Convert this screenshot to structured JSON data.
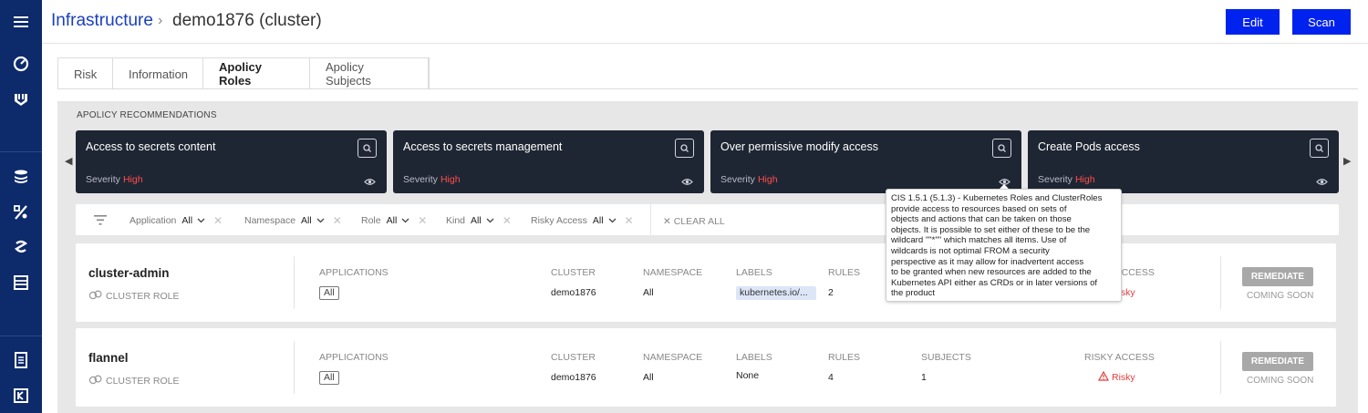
{
  "nav": {
    "icons": [
      "menu-icon",
      "gauge-icon",
      "shield-icon",
      "layers-icon",
      "percent-icon",
      "scan-icon",
      "server-icon",
      "document-icon",
      "compliance-icon"
    ]
  },
  "breadcrumb": {
    "root": "Infrastructure",
    "separator": "›",
    "current": "demo1876 (cluster)"
  },
  "header": {
    "edit_label": "Edit",
    "scan_label": "Scan",
    "accent": "#0022ee"
  },
  "tabs": [
    "Risk",
    "Information",
    "Apolicy Roles",
    "Apolicy Subjects"
  ],
  "active_tab": "Apolicy Roles",
  "recommendations": {
    "title": "APOLICY RECOMMENDATIONS",
    "severity_label": "Severity",
    "cards": [
      {
        "title": "Access to secrets content",
        "severity": "High"
      },
      {
        "title": "Access to secrets management",
        "severity": "High"
      },
      {
        "title": "Over permissive modify access",
        "severity": "High"
      },
      {
        "title": "Create Pods access",
        "severity": "High"
      }
    ]
  },
  "filters": {
    "items": [
      {
        "label": "Application",
        "value": "All"
      },
      {
        "label": "Namespace",
        "value": "All"
      },
      {
        "label": "Role",
        "value": "All"
      },
      {
        "label": "Kind",
        "value": "All"
      },
      {
        "label": "Risky Access",
        "value": "All"
      }
    ],
    "clear_all": "✕ CLEAR ALL"
  },
  "columns": {
    "applications": "APPLICATIONS",
    "cluster": "CLUSTER",
    "namespace": "NAMESPACE",
    "labels": "LABELS",
    "rules": "RULES",
    "subjects": "SUBJECTS",
    "risky_access": "RISKY ACCESS"
  },
  "rows": [
    {
      "name": "cluster-admin",
      "type": "CLUSTER ROLE",
      "applications": "All",
      "cluster": "demo1876",
      "namespace": "All",
      "labels": "kubernetes.io/...",
      "rules": "2",
      "subjects": "",
      "risky_access": "Risky",
      "remediate": "REMEDIATE",
      "coming_soon": "COMING SOON"
    },
    {
      "name": "flannel",
      "type": "CLUSTER ROLE",
      "applications": "All",
      "cluster": "demo1876",
      "namespace": "All",
      "labels": "None",
      "rules": "4",
      "subjects": "1",
      "risky_access": "Risky",
      "remediate": "REMEDIATE",
      "coming_soon": "COMING SOON"
    }
  ],
  "tooltip": {
    "lines": [
      "CIS 1.5.1 (5.1.3) - Kubernetes Roles and ClusterRoles",
      "provide access to resources based on sets of",
      "objects and actions that can be taken on those",
      "objects. It is possible to set either of these to be the",
      "wildcard \"\"*\"\" which matches all items. Use of",
      "wildcards is not optimal FROM a security",
      "perspective as it may allow for inadvertent access",
      "to be granted when new resources are added to the",
      "Kubernetes API either as CRDs or in later versions of",
      "the product"
    ]
  },
  "colors": {
    "rail": "#0d2a6b",
    "card": "#1f2633",
    "severity_high": "#ff4d4d",
    "risky": "#e23d3d"
  }
}
